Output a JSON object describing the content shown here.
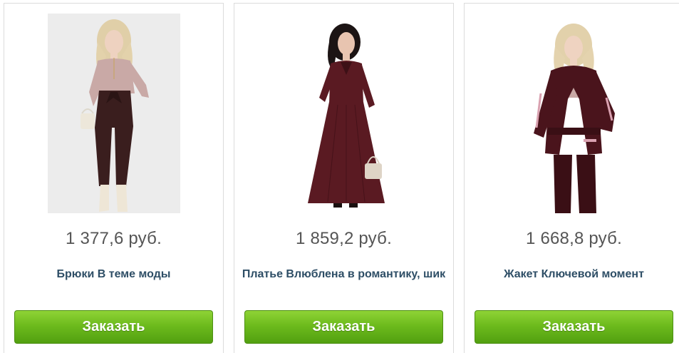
{
  "products": [
    {
      "price": "1 377,6 руб.",
      "name": "Брюки В теме моды",
      "button_label": "Заказать",
      "image_alt": "product-photo-trousers"
    },
    {
      "price": "1 859,2 руб.",
      "name": "Платье Влюблена в романтику, шик",
      "button_label": "Заказать",
      "image_alt": "product-photo-dress"
    },
    {
      "price": "1 668,8 руб.",
      "name": "Жакет Ключевой момент",
      "button_label": "Заказать",
      "image_alt": "product-photo-jacket"
    }
  ],
  "colors": {
    "price_text": "#555555",
    "name_text": "#2e4e66",
    "button_top": "#8fd336",
    "button_bottom": "#52a010",
    "card_border": "#dcdcdc",
    "garment_burgundy": "#5a1a22",
    "garment_brown": "#3a1e1e",
    "top_pink": "#c9a9a6"
  }
}
